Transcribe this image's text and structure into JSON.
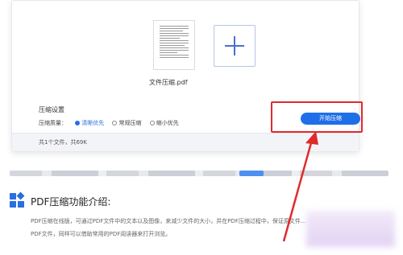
{
  "upload": {
    "file_name": "文件压缩.pdf",
    "add_label": "+"
  },
  "settings": {
    "title": "压缩设置",
    "quality_label": "压缩质量：",
    "options": [
      "清晰优先",
      "常规压缩",
      "缩小优先"
    ],
    "selected": "清晰优先",
    "start_button": "开始压缩"
  },
  "footer": {
    "file_count": "共1个文件，共69K"
  },
  "intro": {
    "title": "PDF压缩功能介绍:",
    "line1": "PDF压缩在线版，可通过PDF文件中的文本以及图像，来减少文件的大小，并在PDF压缩过程中，保证原文件...",
    "line2": "PDF文件，同样可以借助常用的PDF阅读器来打开浏览。"
  },
  "colors": {
    "accent": "#1f6fe8",
    "highlight": "#e02a2a"
  },
  "icons": {
    "add": "plus-icon",
    "section": "grid-icon",
    "arrow": "red-arrow"
  }
}
